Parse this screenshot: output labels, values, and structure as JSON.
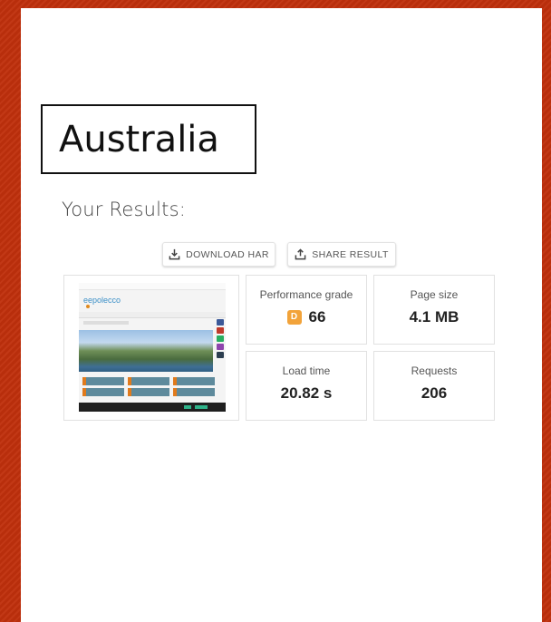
{
  "location": "Australia",
  "heading": "Your Results:",
  "actions": {
    "download_label": "DOWNLOAD HAR",
    "share_label": "SHARE RESULT"
  },
  "metrics": {
    "performance": {
      "label": "Performance grade",
      "grade": "D",
      "score": "66",
      "grade_color": "#f2a33a"
    },
    "page_size": {
      "label": "Page size",
      "value": "4.1 MB"
    },
    "load_time": {
      "label": "Load time",
      "value": "20.82 s"
    },
    "requests": {
      "label": "Requests",
      "value": "206"
    }
  },
  "thumbnail": {
    "site_logo": "eepolecco"
  },
  "colors": {
    "background": "#c0300c",
    "panel": "#ffffff"
  }
}
